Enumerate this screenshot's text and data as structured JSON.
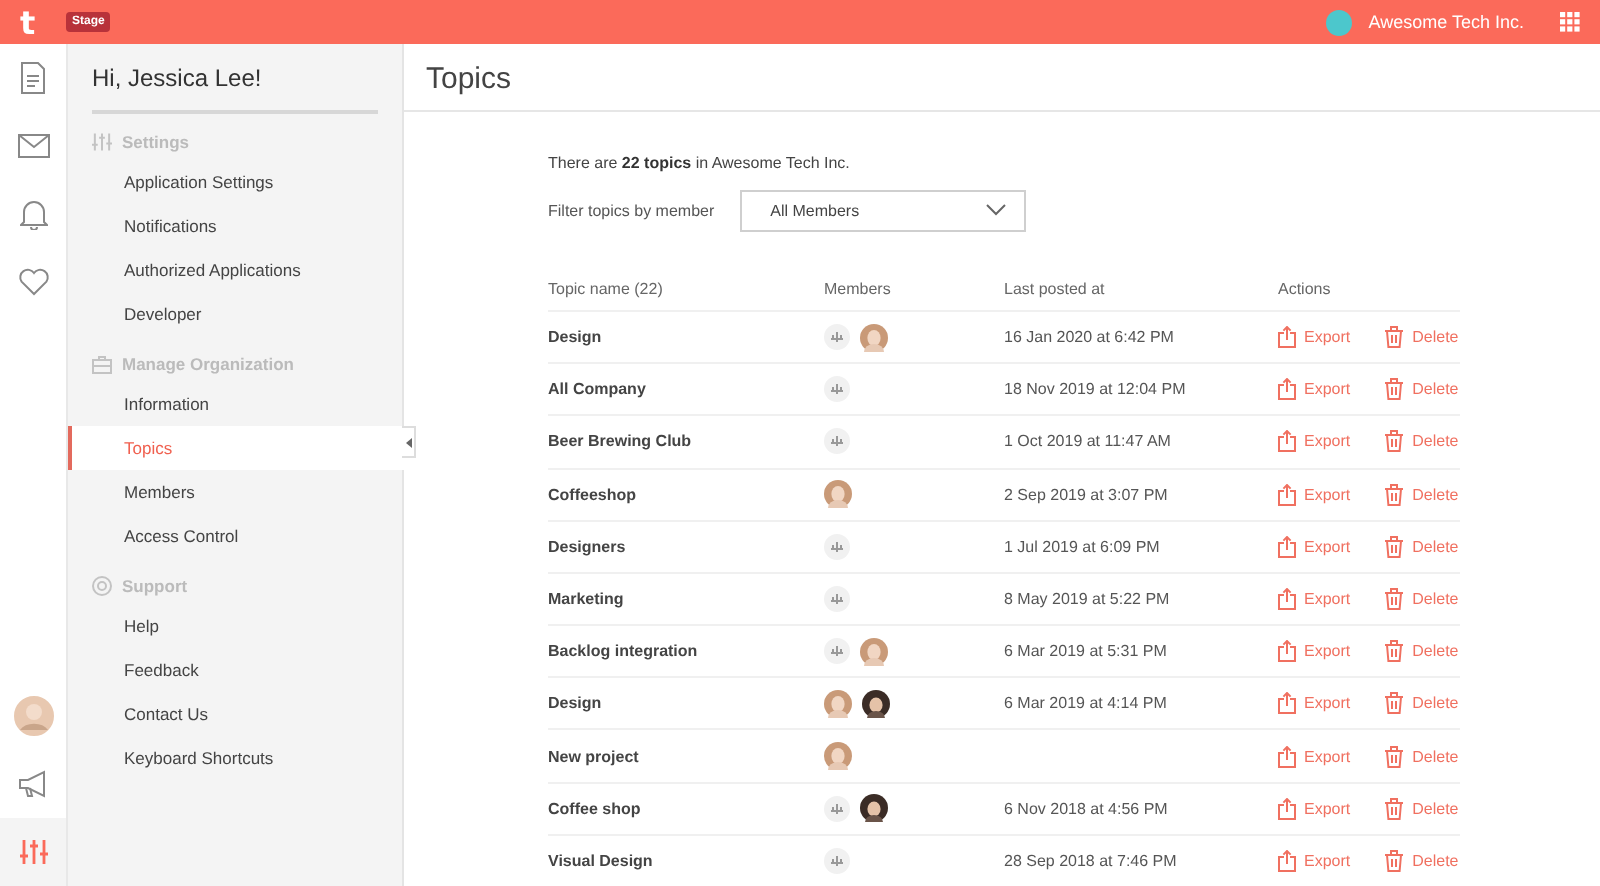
{
  "top_bar": {
    "logo": "t",
    "badge": "Stage",
    "org_name": "Awesome Tech Inc."
  },
  "rail": {
    "items": [
      {
        "kind": "document",
        "selected": false
      },
      {
        "kind": "mail",
        "selected": false
      },
      {
        "kind": "bell",
        "selected": false
      },
      {
        "kind": "heart",
        "selected": false
      }
    ],
    "bottom": [
      {
        "kind": "avatar",
        "selected": false
      },
      {
        "kind": "megaphone",
        "selected": false
      },
      {
        "kind": "sliders",
        "selected": true
      }
    ]
  },
  "sidebar": {
    "greeting": "Hi, Jessica Lee!",
    "sections": [
      {
        "title": "Settings",
        "kind": "sliders",
        "items": [
          {
            "label": "Application Settings",
            "selected": false
          },
          {
            "label": "Notifications",
            "selected": false
          },
          {
            "label": "Authorized Applications",
            "selected": false
          },
          {
            "label": "Developer",
            "selected": false
          }
        ]
      },
      {
        "title": "Manage Organization",
        "kind": "briefcase",
        "items": [
          {
            "label": "Information",
            "selected": false
          },
          {
            "label": "Topics",
            "selected": true
          },
          {
            "label": "Members",
            "selected": false
          },
          {
            "label": "Access Control",
            "selected": false
          }
        ]
      },
      {
        "title": "Support",
        "kind": "lifebuoy",
        "items": [
          {
            "label": "Help",
            "selected": false
          },
          {
            "label": "Feedback",
            "selected": false
          },
          {
            "label": "Contact Us",
            "selected": false
          },
          {
            "label": "Keyboard Shortcuts",
            "selected": false
          }
        ]
      }
    ]
  },
  "page": {
    "title": "Topics",
    "summary": "There are **22 topics** in Awesome Tech Inc.",
    "filter_label": "Filter topics by member",
    "filter_value": "All Members",
    "table": {
      "columns": [
        "Topic name (22)",
        "Members",
        "Last posted at",
        "Actions"
      ],
      "rows": [
        {
          "name": "Design",
          "members": [
            {
              "kind": "bot"
            },
            {
              "kind": "avatar"
            }
          ],
          "last_posted": "16 Jan 2020 at 6:42 PM",
          "export": "Export",
          "delete": "Delete"
        },
        {
          "name": "All Company",
          "members": [
            {
              "kind": "bot"
            }
          ],
          "last_posted": "18 Nov 2019 at 12:04 PM",
          "export": "Export",
          "delete": "Delete"
        },
        {
          "name": "Beer Brewing Club",
          "members": [
            {
              "kind": "bot"
            }
          ],
          "last_posted": "1 Oct 2019 at 11:47 AM",
          "export": "Export",
          "delete": "Delete"
        },
        {
          "name": "Coffeeshop",
          "members": [
            {
              "kind": "avatar"
            }
          ],
          "last_posted": "2 Sep 2019 at 3:07 PM",
          "export": "Export",
          "delete": "Delete"
        },
        {
          "name": "Designers",
          "members": [
            {
              "kind": "bot"
            }
          ],
          "last_posted": "1 Jul 2019 at 6:09 PM",
          "export": "Export",
          "delete": "Delete"
        },
        {
          "name": "Marketing",
          "members": [
            {
              "kind": "bot"
            }
          ],
          "last_posted": "8 May 2019 at 5:22 PM",
          "export": "Export",
          "delete": "Delete"
        },
        {
          "name": "Backlog integration",
          "members": [
            {
              "kind": "bot"
            },
            {
              "kind": "avatar"
            }
          ],
          "last_posted": "6 Mar 2019 at 5:31 PM",
          "export": "Export",
          "delete": "Delete"
        },
        {
          "name": "Design",
          "members": [
            {
              "kind": "avatar"
            },
            {
              "kind": "avatar-dark"
            }
          ],
          "last_posted": "6 Mar 2019 at 4:14 PM",
          "export": "Export",
          "delete": "Delete"
        },
        {
          "name": "New project",
          "members": [
            {
              "kind": "avatar"
            }
          ],
          "export": "Export",
          "delete": "Delete"
        },
        {
          "name": "Coffee shop",
          "members": [
            {
              "kind": "bot"
            },
            {
              "kind": "avatar-dark"
            }
          ],
          "last_posted": "6 Nov 2018 at 4:56 PM",
          "export": "Export",
          "delete": "Delete"
        },
        {
          "name": "Visual Design",
          "members": [
            {
              "kind": "bot"
            }
          ],
          "last_posted": "28 Sep 2018 at 7:46 PM",
          "export": "Export",
          "delete": "Delete"
        }
      ]
    }
  }
}
